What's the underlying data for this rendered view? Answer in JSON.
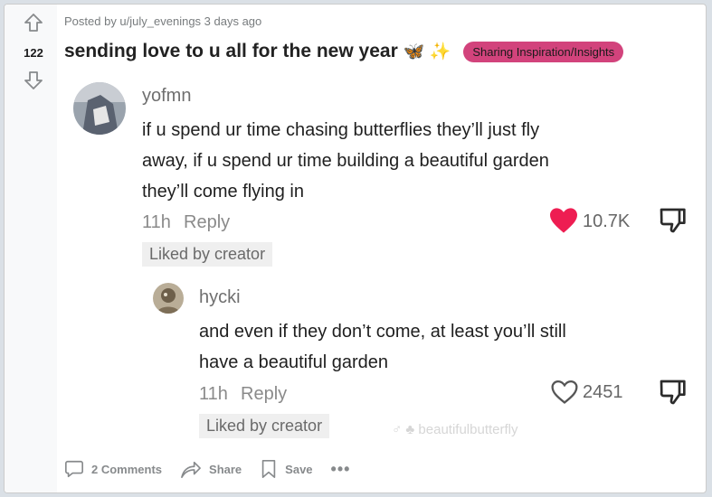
{
  "post": {
    "meta": "Posted by u/july_evenings 3 days ago",
    "score": "122",
    "title": "sending love to u all for the new year",
    "title_emoji": "🦋 ✨",
    "flair": "Sharing Inspiration/Insights",
    "flair_color": "#d2437c"
  },
  "comments": [
    {
      "username": "yofmn",
      "text_lines": [
        "if u spend ur time chasing butterflies they’ll just fly",
        "away, if u spend ur time building a beautiful garden",
        "they’ll come flying in"
      ],
      "time": "11h",
      "reply_label": "Reply",
      "likes": "10.7K",
      "liked_by_creator": "Liked by creator",
      "heart_color": "#ee1d52"
    },
    {
      "username": "hycki",
      "text_lines": [
        "and even if they don’t come, at least you’ll still",
        "have a beautiful garden"
      ],
      "time": "11h",
      "reply_label": "Reply",
      "likes": "2451",
      "liked_by_creator": "Liked by creator"
    }
  ],
  "watermark": "♂ ♣ beautifulbutterfly",
  "actions": {
    "comments": "2 Comments",
    "share": "Share",
    "save": "Save",
    "more": "•••"
  }
}
